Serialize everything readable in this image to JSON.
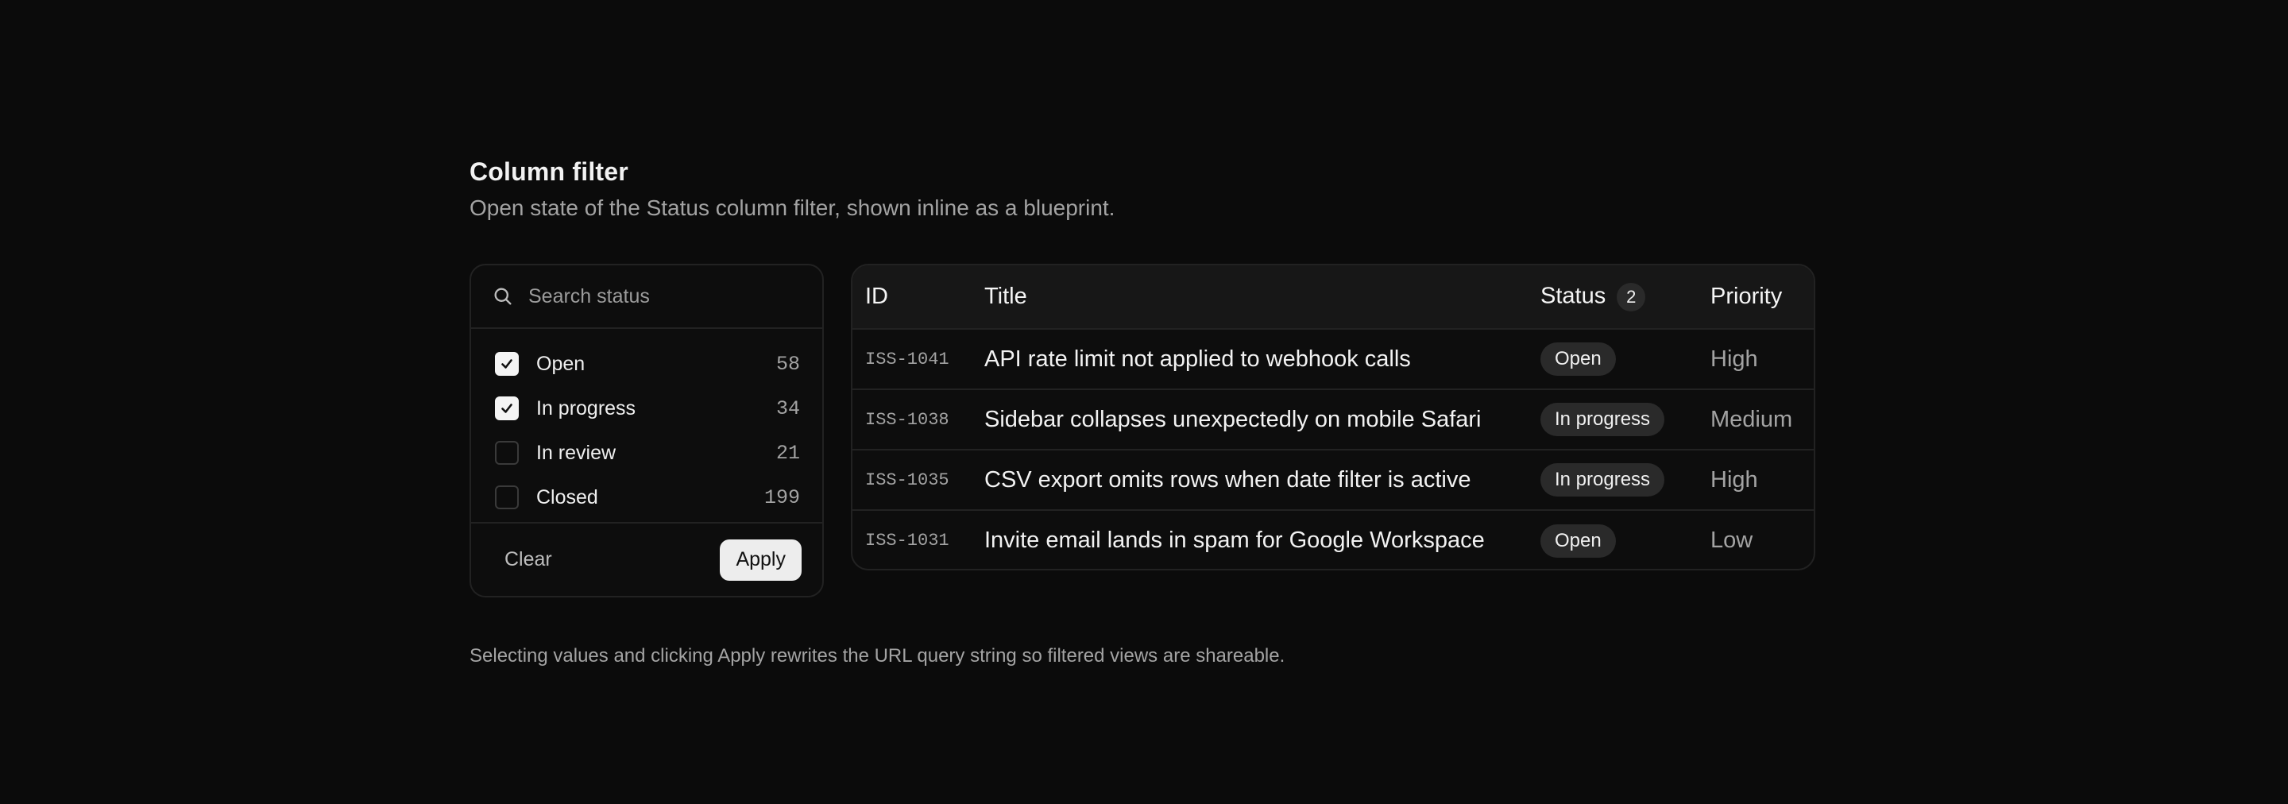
{
  "header": {
    "title": "Column filter",
    "subtitle": "Open state of the Status column filter, shown inline as a blueprint."
  },
  "filter": {
    "search_placeholder": "Search status",
    "options": [
      {
        "label": "Open",
        "count": "58",
        "checked": true
      },
      {
        "label": "In progress",
        "count": "34",
        "checked": true
      },
      {
        "label": "In review",
        "count": "21",
        "checked": false
      },
      {
        "label": "Closed",
        "count": "199",
        "checked": false
      }
    ],
    "clear_label": "Clear",
    "apply_label": "Apply"
  },
  "table": {
    "columns": {
      "id": "ID",
      "title": "Title",
      "status": "Status",
      "status_filter_count": "2",
      "priority": "Priority"
    },
    "rows": [
      {
        "id": "ISS-1041",
        "title": "API rate limit not applied to webhook calls",
        "status": "Open",
        "priority": "High"
      },
      {
        "id": "ISS-1038",
        "title": "Sidebar collapses unexpectedly on mobile Safari",
        "status": "In progress",
        "priority": "Medium"
      },
      {
        "id": "ISS-1035",
        "title": "CSV export omits rows when date filter is active",
        "status": "In progress",
        "priority": "High"
      },
      {
        "id": "ISS-1031",
        "title": "Invite email lands in spam for Google Workspace",
        "status": "Open",
        "priority": "Low"
      }
    ]
  },
  "footnote": "Selecting values and clicking Apply rewrites the URL query string so filtered views are shareable.",
  "icons": {
    "search": "search-icon",
    "check": "check-icon"
  },
  "colors": {
    "background": "#0b0b0b",
    "badge": "#2a2a2a",
    "apply_button": "#ededed"
  }
}
